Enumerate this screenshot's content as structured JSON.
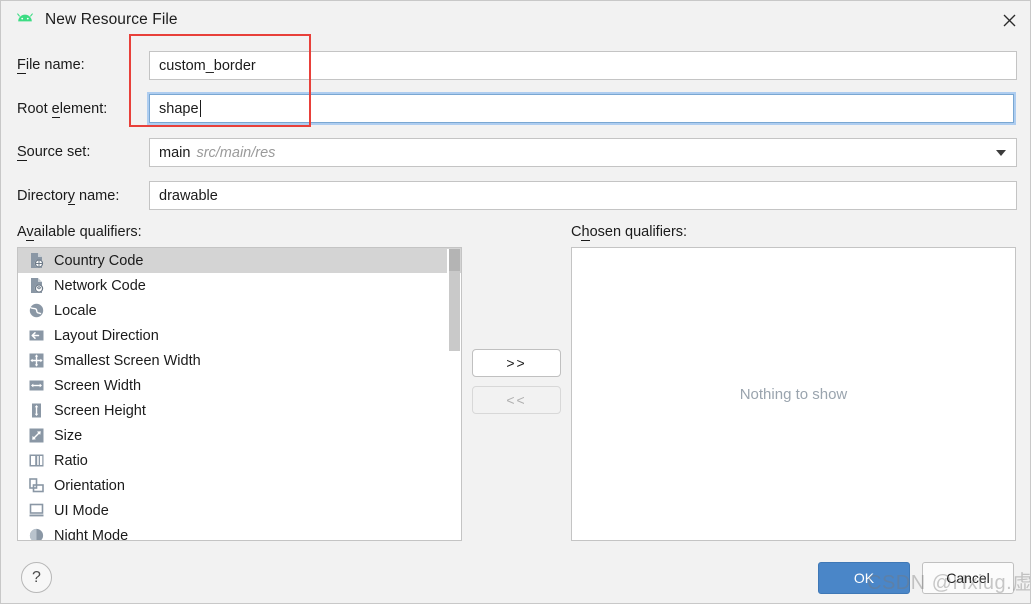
{
  "window": {
    "title": "New Resource File",
    "app_icon": "android-robot-icon",
    "close_icon": "close-icon"
  },
  "form": {
    "file_name": {
      "label_pre": "F",
      "label_mnemonic": "",
      "label": "File name:",
      "label_a": "F",
      "label_b": "ile name:",
      "value": "custom_border",
      "focused": false
    },
    "root_element": {
      "label_a": "Root ",
      "label_mn": "e",
      "label_b": "lement:",
      "value": "shape",
      "focused": true
    },
    "source_set": {
      "label_mn": "S",
      "label_b": "ource set:",
      "value_main": "main",
      "value_path": "src/main/res",
      "dropdown_icon": "chevron-down-icon"
    },
    "directory_name": {
      "label_a": "Director",
      "label_mn": "y",
      "label_b": " name:",
      "value": "drawable"
    }
  },
  "qualifiers": {
    "available_label_a": "A",
    "available_label_mn": "v",
    "available_label_b": "ailable qualifiers:",
    "chosen_label_a": "C",
    "chosen_label_mn": "h",
    "chosen_label_b": "osen qualifiers:",
    "available_items": [
      {
        "label": "Country Code",
        "icon": "country-code-icon",
        "selected": true
      },
      {
        "label": "Network Code",
        "icon": "network-code-icon",
        "selected": false
      },
      {
        "label": "Locale",
        "icon": "globe-icon",
        "selected": false
      },
      {
        "label": "Layout Direction",
        "icon": "arrow-left-icon",
        "selected": false
      },
      {
        "label": "Smallest Screen Width",
        "icon": "resize-all-icon",
        "selected": false
      },
      {
        "label": "Screen Width",
        "icon": "arrow-horizontal-icon",
        "selected": false
      },
      {
        "label": "Screen Height",
        "icon": "arrow-vertical-icon",
        "selected": false
      },
      {
        "label": "Size",
        "icon": "diagonal-resize-icon",
        "selected": false
      },
      {
        "label": "Ratio",
        "icon": "ratio-icon",
        "selected": false
      },
      {
        "label": "Orientation",
        "icon": "orientation-icon",
        "selected": false
      },
      {
        "label": "UI Mode",
        "icon": "ui-mode-icon",
        "selected": false
      },
      {
        "label": "Night Mode",
        "icon": "night-mode-icon",
        "selected": false
      }
    ],
    "chosen_empty_text": "Nothing to show",
    "add_button": ">>",
    "remove_button": "<<",
    "add_enabled": true,
    "remove_enabled": false
  },
  "footer": {
    "help_label": "?",
    "ok_label": "OK",
    "cancel_label": "Cancel"
  },
  "annotation": {
    "color": "#e8403a"
  },
  "watermark": {
    "text": "CSDN @Hxiug.虚晨"
  }
}
